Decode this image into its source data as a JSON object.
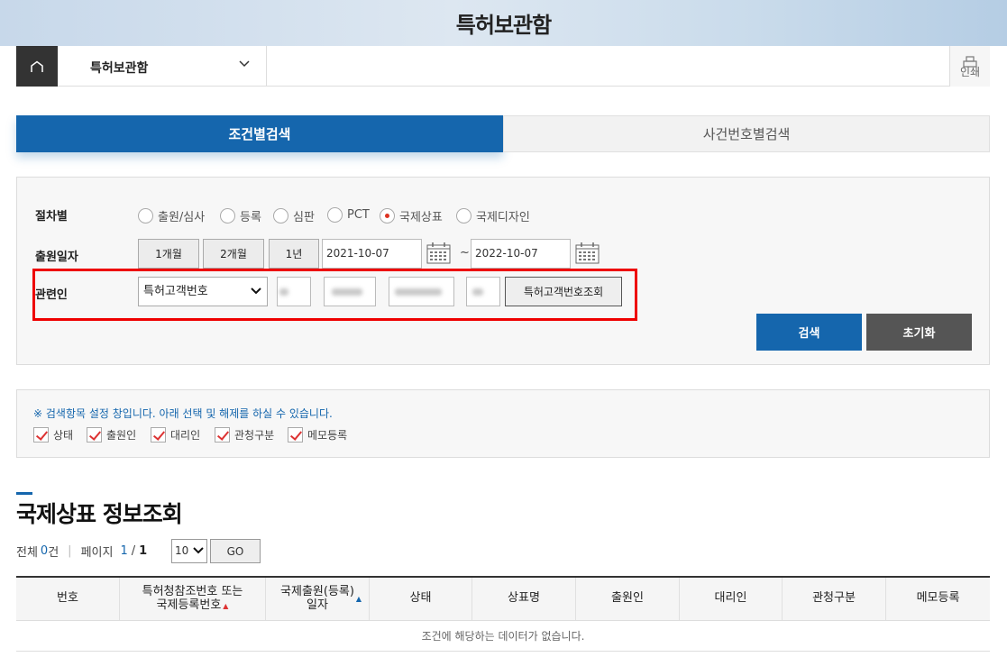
{
  "header": {
    "title": "특허보관함"
  },
  "navbar": {
    "menu_label": "특허보관함",
    "print_label": "인쇄"
  },
  "tabs": [
    {
      "label": "조건별검색",
      "active": true
    },
    {
      "label": "사건번호별검색",
      "active": false
    }
  ],
  "search": {
    "procedure_label": "절차별",
    "procedure_options": [
      {
        "label": "출원/심사",
        "selected": false
      },
      {
        "label": "등록",
        "selected": false
      },
      {
        "label": "심판",
        "selected": false
      },
      {
        "label": "PCT",
        "selected": false
      },
      {
        "label": "국제상표",
        "selected": true
      },
      {
        "label": "국제디자인",
        "selected": false
      }
    ],
    "date_label": "출원일자",
    "period_buttons": [
      "1개월",
      "2개월",
      "1년"
    ],
    "date_from": "2021-10-07",
    "date_sep": "~",
    "date_to": "2022-10-07",
    "party_label": "관련인",
    "party_type": "특허고객번호",
    "lookup_button": "특허고객번호조회",
    "search_button": "검색",
    "reset_button": "초기화"
  },
  "options": {
    "note": "※ 검색항목 설정 창입니다. 아래 선택 및 해제를 하실 수 있습니다.",
    "items": [
      "상태",
      "출원인",
      "대리인",
      "관청구분",
      "메모등록"
    ]
  },
  "results": {
    "title": "국제상표 정보조회",
    "total_prefix": "전체",
    "total_count": "0",
    "total_suffix": "건",
    "page_label": "페이지",
    "page_current": "1",
    "page_sep": "/",
    "page_total": "1",
    "page_size": "10",
    "go_button": "GO",
    "columns": [
      {
        "label": "번호",
        "sub": ""
      },
      {
        "label": "특허청참조번호 또는",
        "sub": "국제등록번호"
      },
      {
        "label": "국제출원(등록)",
        "sub": "일자"
      },
      {
        "label": "상태",
        "sub": ""
      },
      {
        "label": "상표명",
        "sub": ""
      },
      {
        "label": "출원인",
        "sub": ""
      },
      {
        "label": "대리인",
        "sub": ""
      },
      {
        "label": "관청구분",
        "sub": ""
      },
      {
        "label": "메모등록",
        "sub": ""
      }
    ],
    "empty_message": "조건에 해당하는 데이터가 없습니다."
  },
  "colors": {
    "primary": "#1566ad",
    "highlight": "#e00000",
    "dark_button": "#555555"
  }
}
